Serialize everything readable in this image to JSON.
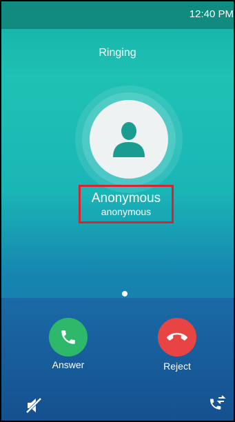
{
  "status_bar": {
    "time": "12:40 PM"
  },
  "call": {
    "status": "Ringing",
    "caller_name": "Anonymous",
    "caller_id": "anonymous"
  },
  "actions": {
    "answer_label": "Answer",
    "reject_label": "Reject"
  },
  "icons": {
    "avatar": "person-icon",
    "answer": "phone-icon",
    "reject": "hangup-icon",
    "mute": "mute-icon",
    "transfer": "transfer-icon"
  },
  "colors": {
    "answer": "#2eb86a",
    "reject": "#e84444",
    "highlight": "#d9232d"
  }
}
